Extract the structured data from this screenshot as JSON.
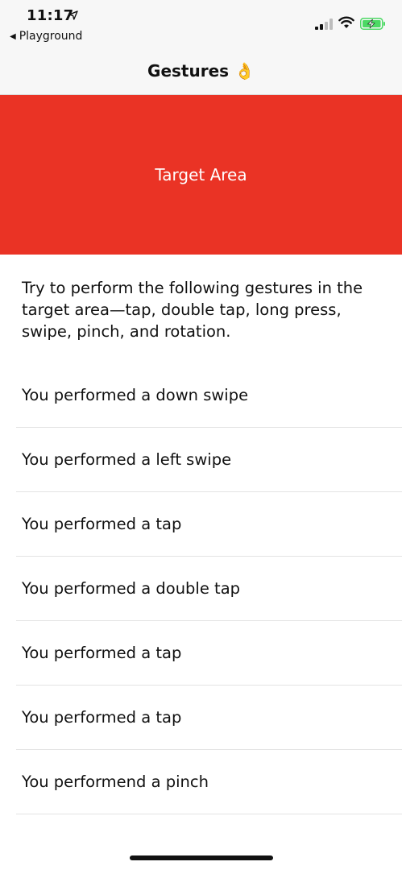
{
  "status_bar": {
    "time": "11:17",
    "back_label": "Playground",
    "back_arrow": "◀",
    "location_icon": "location-arrow-icon",
    "signal_icon": "cellular-signal-icon",
    "wifi_icon": "wifi-icon",
    "battery_icon": "battery-charging-icon",
    "battery_color": "#4cd964"
  },
  "nav": {
    "title": "Gestures 👌"
  },
  "target": {
    "label": "Target Area",
    "color": "#ea3325"
  },
  "instructions": "Try to perform the following gestures in the target area—tap, double tap, long press, swipe, pinch, and rotation.",
  "log": [
    "You performed a down swipe",
    "You performed a left swipe",
    "You performed a tap",
    "You performed a double tap",
    "You performed a tap",
    "You performed a tap",
    "You performend a pinch"
  ]
}
